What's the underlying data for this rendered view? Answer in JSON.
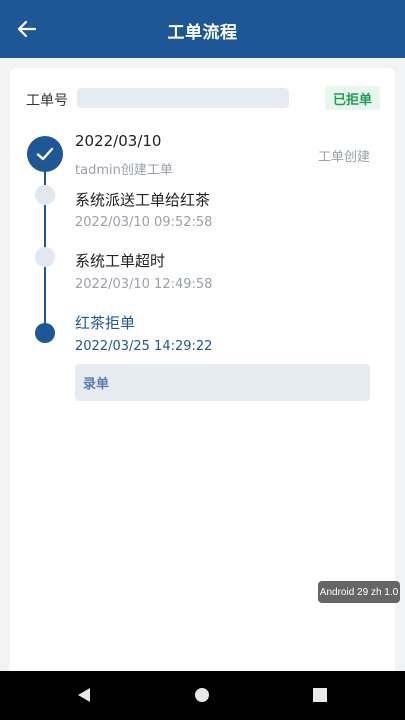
{
  "appbar": {
    "title": "工单流程",
    "back_icon": "arrow-left-icon"
  },
  "order": {
    "label": "工单号",
    "value": "",
    "status": "已拒单"
  },
  "colors": {
    "primary": "#1d5796",
    "status_green": "#1e9e55",
    "status_green_bg": "#e8f6ee"
  },
  "timeline": [
    {
      "title": "2022/03/10",
      "sub": "tadmin创建工单",
      "tag": "工单创建",
      "state": "done"
    },
    {
      "title": "系统派送工单给红茶",
      "sub": "2022/03/10  09:52:58",
      "state": "pending"
    },
    {
      "title": "系统工单超时",
      "sub": "2022/03/10  12:49:58",
      "state": "pending"
    },
    {
      "title": "红茶拒单",
      "sub": "2022/03/25  14:29:22",
      "state": "current"
    }
  ],
  "record": {
    "label": "录单"
  },
  "toast": {
    "text": "Android 29 zh 1.0"
  },
  "nav": {
    "back_icon": "triangle-back-icon",
    "home_icon": "circle-home-icon",
    "recent_icon": "square-recent-icon"
  }
}
